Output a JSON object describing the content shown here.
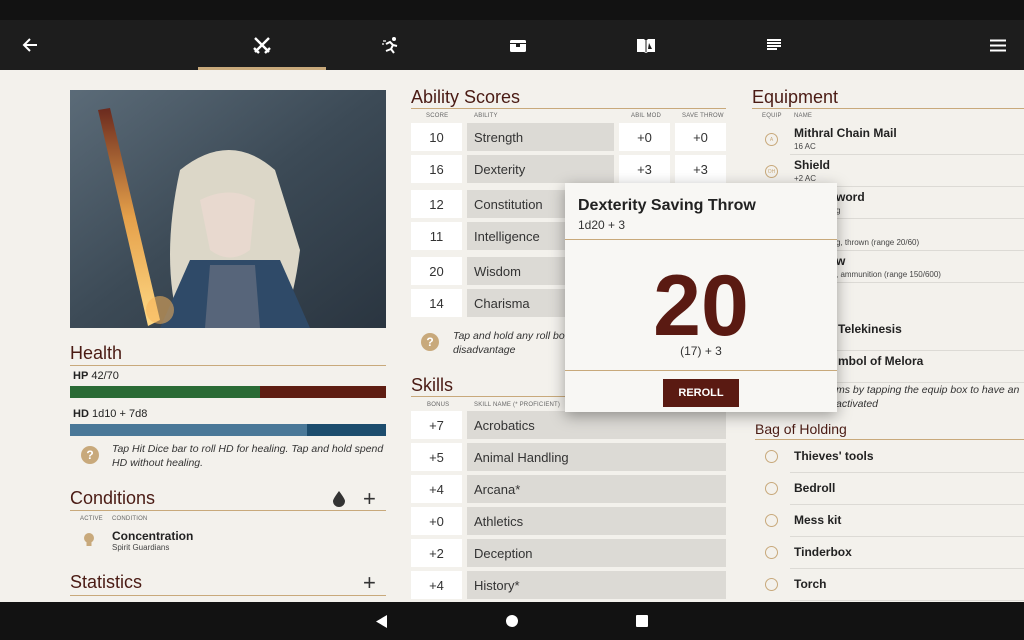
{
  "colors": {
    "accent": "#c8a97b",
    "dark_red": "#5a1a12",
    "hp_green": "#2a6b35",
    "hd_blue": "#4a7898"
  },
  "topbar": {
    "back_icon": "arrow-left-icon",
    "tabs": [
      {
        "name": "combat",
        "icon": "crossed-swords-icon",
        "active": true
      },
      {
        "name": "skills",
        "icon": "running-figure-icon"
      },
      {
        "name": "inventory",
        "icon": "chest-icon"
      },
      {
        "name": "spells",
        "icon": "spellbook-icon"
      },
      {
        "name": "notes",
        "icon": "notes-icon"
      }
    ],
    "menu_icon": "hamburger-menu-icon"
  },
  "health": {
    "title": "Health",
    "hp_label": "HP",
    "hp_value": "42/70",
    "hp_fraction": 0.6,
    "hd_label": "HD",
    "hd_value": "1d10 + 7d8",
    "hd_fraction": 0.75,
    "hint": "Tap Hit Dice bar to roll HD for healing. Tap and hold spend HD without healing."
  },
  "conditions": {
    "title": "Conditions",
    "col_active": "ACTIVE",
    "col_condition": "CONDITION",
    "items": [
      {
        "name": "Concentration",
        "sub": "Spirit Guardians"
      }
    ]
  },
  "statistics": {
    "title": "Statistics"
  },
  "abilities": {
    "title": "Ability Scores",
    "col_score": "SCORE",
    "col_ability": "ABILITY",
    "col_mod": "ABIL MOD",
    "col_save": "SAVE THROW",
    "rows": [
      {
        "score": "10",
        "name": "Strength",
        "mod": "+0",
        "save": "+0"
      },
      {
        "score": "16",
        "name": "Dexterity",
        "mod": "+3",
        "save": "+3"
      },
      {
        "score": "12",
        "name": "Constitution",
        "mod": "",
        "save": ""
      },
      {
        "score": "11",
        "name": "Intelligence",
        "mod": "",
        "save": ""
      },
      {
        "score": "20",
        "name": "Wisdom",
        "mod": "",
        "save": ""
      },
      {
        "score": "14",
        "name": "Charisma",
        "mod": "",
        "save": ""
      }
    ],
    "hint": "Tap and hold any roll bo disadvantage"
  },
  "skills": {
    "title": "Skills",
    "col_bonus": "BONUS",
    "col_name": "SKILL NAME (* PROFICIENT)",
    "rows": [
      {
        "bonus": "+7",
        "name": "Acrobatics"
      },
      {
        "bonus": "+5",
        "name": "Animal Handling"
      },
      {
        "bonus": "+4",
        "name": "Arcana*"
      },
      {
        "bonus": "+0",
        "name": "Athletics"
      },
      {
        "bonus": "+2",
        "name": "Deception"
      },
      {
        "bonus": "+4",
        "name": "History*"
      }
    ]
  },
  "equipment": {
    "title": "Equipment",
    "col_equip": "EQUIP",
    "col_name": "NAME",
    "items": [
      {
        "icon": "A",
        "name": "Mithral Chain Mail",
        "sub": "16 AC"
      },
      {
        "icon": "OH",
        "name": "Shield",
        "sub": "+2 AC"
      },
      {
        "icon": "",
        "name": "word",
        "sub": "g"
      },
      {
        "icon": "",
        "name": "",
        "sub": "g, thrown (range 20/60)"
      },
      {
        "icon": "",
        "name": "w",
        "sub": ", ammunition (range 150/600)"
      },
      {
        "icon": "",
        "name": "Telekinesis",
        "sub": ""
      },
      {
        "icon": "",
        "name": "mbol of Melora",
        "sub": ""
      }
    ],
    "hint": "ms by tapping the equip box to have an activated"
  },
  "bag": {
    "title": "Bag of Holding",
    "items": [
      "Thieves' tools",
      "Bedroll",
      "Mess kit",
      "Tinderbox",
      "Torch"
    ]
  },
  "dialog": {
    "title": "Dexterity Saving Throw",
    "formula": "1d20 + 3",
    "result": "20",
    "breakdown": "(17) + 3",
    "button": "REROLL"
  }
}
